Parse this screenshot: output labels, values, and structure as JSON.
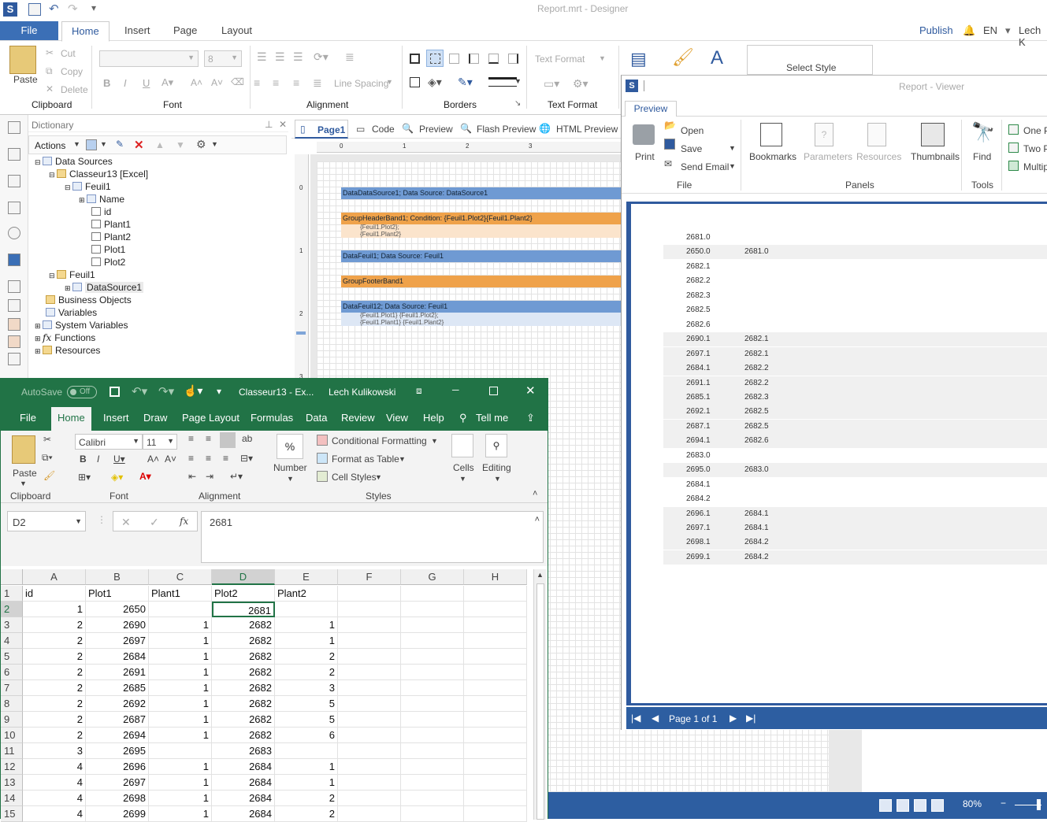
{
  "designer": {
    "title": "Report.mrt - Designer",
    "menu": {
      "file": "File",
      "tabs": [
        "Home",
        "Insert",
        "Page",
        "Layout"
      ],
      "publish": "Publish",
      "lang": "EN",
      "user": "Lech K"
    },
    "ribbon": {
      "paste": "Paste",
      "cut": "Cut",
      "copy": "Copy",
      "delete": "Delete",
      "font_size": "8",
      "line_spacing": "Line Spacing",
      "text_format": "Text Format",
      "select_style": "Select Style",
      "groups": [
        "Clipboard",
        "Font",
        "Alignment",
        "Borders",
        "Text Format"
      ]
    },
    "dictionary": {
      "title": "Dictionary",
      "actions": "Actions",
      "tree": [
        "Data Sources",
        "Classeur13 [Excel]",
        "Feuil1",
        "Name",
        "id",
        "Plant1",
        "Plant2",
        "Plot1",
        "Plot2",
        "Feuil1",
        "DataSource1",
        "Business Objects",
        "Variables",
        "System Variables",
        "Functions",
        "Resources"
      ]
    },
    "page_tabs": [
      "Page1",
      "Code",
      "Preview",
      "Flash Preview",
      "HTML Preview"
    ],
    "ruler": [
      "0",
      "1",
      "2",
      "3"
    ],
    "vruler": [
      "0",
      "1",
      "2",
      "3"
    ],
    "bands": [
      {
        "text": "DataDataSource1; Data Source: DataSource1",
        "color": "blue"
      },
      {
        "text": "GroupHeaderBand1; Condition: {Feuil1.Plot2}{Feuil1.Plant2}",
        "color": "orange"
      },
      {
        "text": "DataFeuil1; Data Source: Feuil1",
        "color": "blue"
      },
      {
        "text": "GroupFooterBand1",
        "color": "orange"
      },
      {
        "text": "DataFeuil12; Data Source: Feuil1",
        "color": "blue"
      }
    ],
    "band_exprs": [
      "{Feuil1.Plot2}; ",
      "{Feuil1.Plant2} ",
      "{Feuil1.Plot1} {Feuil1.Plot2}; ",
      "{Feuil1.Plant1} {Feuil1.Plant2} "
    ],
    "zoom": "80%"
  },
  "viewer": {
    "title": "Report - Viewer",
    "tab": "Preview",
    "buttons": {
      "print": "Print",
      "open": "Open",
      "save": "Save",
      "send_email": "Send Email",
      "bookmarks": "Bookmarks",
      "parameters": "Parameters",
      "resources": "Resources",
      "thumbnails": "Thumbnails",
      "find": "Find",
      "one_page": "One P",
      "two_pages": "Two P",
      "multiple": "Multipl"
    },
    "groups": [
      "File",
      "Panels",
      "Tools"
    ],
    "rows": [
      {
        "a": "2681.0",
        "b": "",
        "shade": false
      },
      {
        "a": "2650.0",
        "b": "2681.0",
        "shade": true
      },
      {
        "a": "2682.1",
        "b": "",
        "shade": false
      },
      {
        "a": "2682.2",
        "b": "",
        "shade": false
      },
      {
        "a": "2682.3",
        "b": "",
        "shade": false
      },
      {
        "a": "2682.5",
        "b": "",
        "shade": false
      },
      {
        "a": "2682.6",
        "b": "",
        "shade": false
      },
      {
        "a": "2690.1",
        "b": "2682.1",
        "shade": true
      },
      {
        "a": "2697.1",
        "b": "2682.1",
        "shade": true
      },
      {
        "a": "2684.1",
        "b": "2682.2",
        "shade": true
      },
      {
        "a": "2691.1",
        "b": "2682.2",
        "shade": true
      },
      {
        "a": "2685.1",
        "b": "2682.3",
        "shade": true
      },
      {
        "a": "2692.1",
        "b": "2682.5",
        "shade": true
      },
      {
        "a": "2687.1",
        "b": "2682.5",
        "shade": true
      },
      {
        "a": "2694.1",
        "b": "2682.6",
        "shade": true
      },
      {
        "a": "2683.0",
        "b": "",
        "shade": false
      },
      {
        "a": "2695.0",
        "b": "2683.0",
        "shade": true
      },
      {
        "a": "2684.1",
        "b": "",
        "shade": false
      },
      {
        "a": "2684.2",
        "b": "",
        "shade": false
      },
      {
        "a": "2696.1",
        "b": "2684.1",
        "shade": true
      },
      {
        "a": "2697.1",
        "b": "2684.1",
        "shade": true
      },
      {
        "a": "2698.1",
        "b": "2684.2",
        "shade": true
      },
      {
        "a": "2699.1",
        "b": "2684.2",
        "shade": true
      }
    ],
    "page_status": "Page 1 of 1"
  },
  "excel": {
    "autosave": "AutoSave",
    "autosave_state": "Off",
    "doc": "Classeur13 - Ex...",
    "user": "Lech Kulikowski",
    "menu": [
      "File",
      "Home",
      "Insert",
      "Draw",
      "Page Layout",
      "Formulas",
      "Data",
      "Review",
      "View",
      "Help",
      "Tell me"
    ],
    "ribbon": {
      "paste": "Paste",
      "font": "Calibri",
      "size": "11",
      "number_pct": "%",
      "number": "Number",
      "cond_format": "Conditional Formatting",
      "format_table": "Format as Table",
      "cell_styles": "Cell Styles",
      "cells": "Cells",
      "editing": "Editing"
    },
    "groups": [
      "Clipboard",
      "Font",
      "Alignment",
      "Styles"
    ],
    "namebox": "D2",
    "fx": "fx",
    "formula": "2681",
    "columns": [
      "A",
      "B",
      "C",
      "D",
      "E",
      "F",
      "G",
      "H"
    ],
    "rows": [
      {
        "n": "1",
        "c": [
          "id",
          "Plot1",
          "Plant1",
          "Plot2",
          "Plant2",
          "",
          "",
          ""
        ]
      },
      {
        "n": "2",
        "c": [
          "1",
          "2650",
          "",
          "2681",
          "",
          "",
          "",
          ""
        ]
      },
      {
        "n": "3",
        "c": [
          "2",
          "2690",
          "1",
          "2682",
          "1",
          "",
          "",
          ""
        ]
      },
      {
        "n": "4",
        "c": [
          "2",
          "2697",
          "1",
          "2682",
          "1",
          "",
          "",
          ""
        ]
      },
      {
        "n": "5",
        "c": [
          "2",
          "2684",
          "1",
          "2682",
          "2",
          "",
          "",
          ""
        ]
      },
      {
        "n": "6",
        "c": [
          "2",
          "2691",
          "1",
          "2682",
          "2",
          "",
          "",
          ""
        ]
      },
      {
        "n": "7",
        "c": [
          "2",
          "2685",
          "1",
          "2682",
          "3",
          "",
          "",
          ""
        ]
      },
      {
        "n": "8",
        "c": [
          "2",
          "2692",
          "1",
          "2682",
          "5",
          "",
          "",
          ""
        ]
      },
      {
        "n": "9",
        "c": [
          "2",
          "2687",
          "1",
          "2682",
          "5",
          "",
          "",
          ""
        ]
      },
      {
        "n": "10",
        "c": [
          "2",
          "2694",
          "1",
          "2682",
          "6",
          "",
          "",
          ""
        ]
      },
      {
        "n": "11",
        "c": [
          "3",
          "2695",
          "",
          "2683",
          "",
          "",
          "",
          ""
        ]
      },
      {
        "n": "12",
        "c": [
          "4",
          "2696",
          "1",
          "2684",
          "1",
          "",
          "",
          ""
        ]
      },
      {
        "n": "13",
        "c": [
          "4",
          "2697",
          "1",
          "2684",
          "1",
          "",
          "",
          ""
        ]
      },
      {
        "n": "14",
        "c": [
          "4",
          "2698",
          "1",
          "2684",
          "2",
          "",
          "",
          ""
        ]
      },
      {
        "n": "15",
        "c": [
          "4",
          "2699",
          "1",
          "2684",
          "2",
          "",
          "",
          ""
        ]
      }
    ]
  }
}
